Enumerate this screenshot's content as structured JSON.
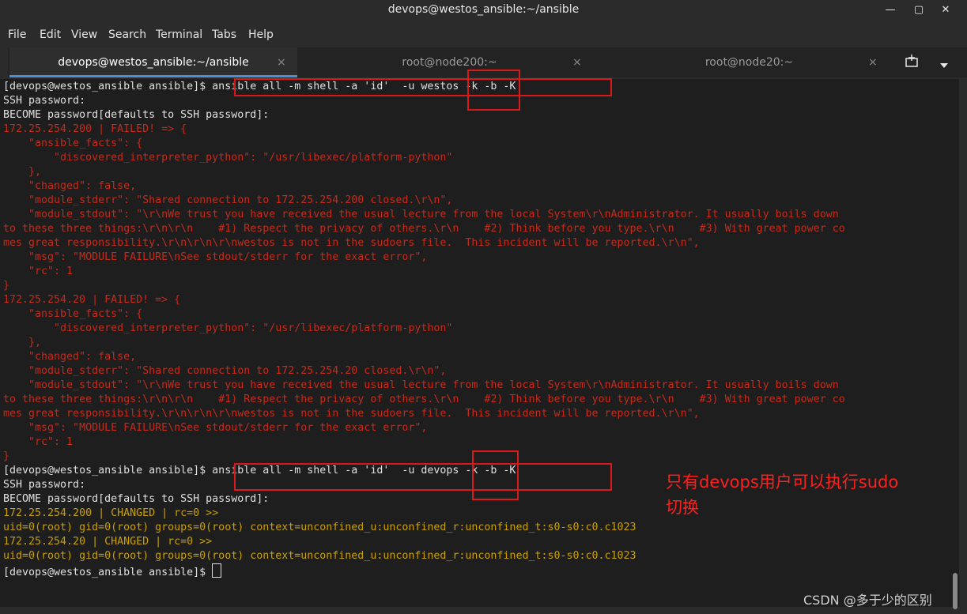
{
  "window": {
    "title": "devops@westos_ansible:~/ansible",
    "minimize": "—",
    "maximize": "▢",
    "close": "✕"
  },
  "menu": [
    "File",
    "Edit",
    "View",
    "Search",
    "Terminal",
    "Tabs",
    "Help"
  ],
  "tabs": [
    {
      "label": "devops@westos_ansible:~/ansible"
    },
    {
      "label": "root@node200:~"
    },
    {
      "label": "root@node20:~"
    }
  ],
  "tab_close": "×",
  "icons": {
    "new_tab": "new-tab-icon",
    "dropdown": "chevron-down-icon"
  },
  "terminal": {
    "lines": [
      {
        "c": "w",
        "t": "[devops@westos_ansible ansible]$ ansible all -m shell -a 'id'  -u westos -k -b -K"
      },
      {
        "c": "w",
        "t": "SSH password:"
      },
      {
        "c": "w",
        "t": "BECOME password[defaults to SSH password]:"
      },
      {
        "c": "r",
        "t": "172.25.254.200 | FAILED! => {"
      },
      {
        "c": "r",
        "t": "    \"ansible_facts\": {"
      },
      {
        "c": "r",
        "t": "        \"discovered_interpreter_python\": \"/usr/libexec/platform-python\""
      },
      {
        "c": "r",
        "t": "    },"
      },
      {
        "c": "r",
        "t": "    \"changed\": false,"
      },
      {
        "c": "r",
        "t": "    \"module_stderr\": \"Shared connection to 172.25.254.200 closed.\\r\\n\","
      },
      {
        "c": "r",
        "t": "    \"module_stdout\": \"\\r\\nWe trust you have received the usual lecture from the local System\\r\\nAdministrator. It usually boils down"
      },
      {
        "c": "r",
        "t": "to these three things:\\r\\n\\r\\n    #1) Respect the privacy of others.\\r\\n    #2) Think before you type.\\r\\n    #3) With great power co"
      },
      {
        "c": "r",
        "t": "mes great responsibility.\\r\\n\\r\\n\\r\\nwestos is not in the sudoers file.  This incident will be reported.\\r\\n\","
      },
      {
        "c": "r",
        "t": "    \"msg\": \"MODULE FAILURE\\nSee stdout/stderr for the exact error\","
      },
      {
        "c": "r",
        "t": "    \"rc\": 1"
      },
      {
        "c": "r",
        "t": "}"
      },
      {
        "c": "r",
        "t": "172.25.254.20 | FAILED! => {"
      },
      {
        "c": "r",
        "t": "    \"ansible_facts\": {"
      },
      {
        "c": "r",
        "t": "        \"discovered_interpreter_python\": \"/usr/libexec/platform-python\""
      },
      {
        "c": "r",
        "t": "    },"
      },
      {
        "c": "r",
        "t": "    \"changed\": false,"
      },
      {
        "c": "r",
        "t": "    \"module_stderr\": \"Shared connection to 172.25.254.20 closed.\\r\\n\","
      },
      {
        "c": "r",
        "t": "    \"module_stdout\": \"\\r\\nWe trust you have received the usual lecture from the local System\\r\\nAdministrator. It usually boils down"
      },
      {
        "c": "r",
        "t": "to these three things:\\r\\n\\r\\n    #1) Respect the privacy of others.\\r\\n    #2) Think before you type.\\r\\n    #3) With great power co"
      },
      {
        "c": "r",
        "t": "mes great responsibility.\\r\\n\\r\\n\\r\\nwestos is not in the sudoers file.  This incident will be reported.\\r\\n\","
      },
      {
        "c": "r",
        "t": "    \"msg\": \"MODULE FAILURE\\nSee stdout/stderr for the exact error\","
      },
      {
        "c": "r",
        "t": "    \"rc\": 1"
      },
      {
        "c": "r",
        "t": "}"
      },
      {
        "c": "w",
        "t": "[devops@westos_ansible ansible]$ ansible all -m shell -a 'id'  -u devops -k -b -K"
      },
      {
        "c": "w",
        "t": "SSH password:"
      },
      {
        "c": "w",
        "t": "BECOME password[defaults to SSH password]:"
      },
      {
        "c": "y",
        "t": "172.25.254.200 | CHANGED | rc=0 >>"
      },
      {
        "c": "y",
        "t": "uid=0(root) gid=0(root) groups=0(root) context=unconfined_u:unconfined_r:unconfined_t:s0-s0:c0.c1023"
      },
      {
        "c": "y",
        "t": "172.25.254.20 | CHANGED | rc=0 >>"
      },
      {
        "c": "y",
        "t": "uid=0(root) gid=0(root) groups=0(root) context=unconfined_u:unconfined_r:unconfined_t:s0-s0:c0.c1023"
      }
    ],
    "prompt": "[devops@westos_ansible ansible]$ "
  },
  "annotation": {
    "line1": "只有devops用户可以执行sudo",
    "line2": "切换",
    "color": "#ff1f1f"
  },
  "watermark": "CSDN @多于少的区别"
}
